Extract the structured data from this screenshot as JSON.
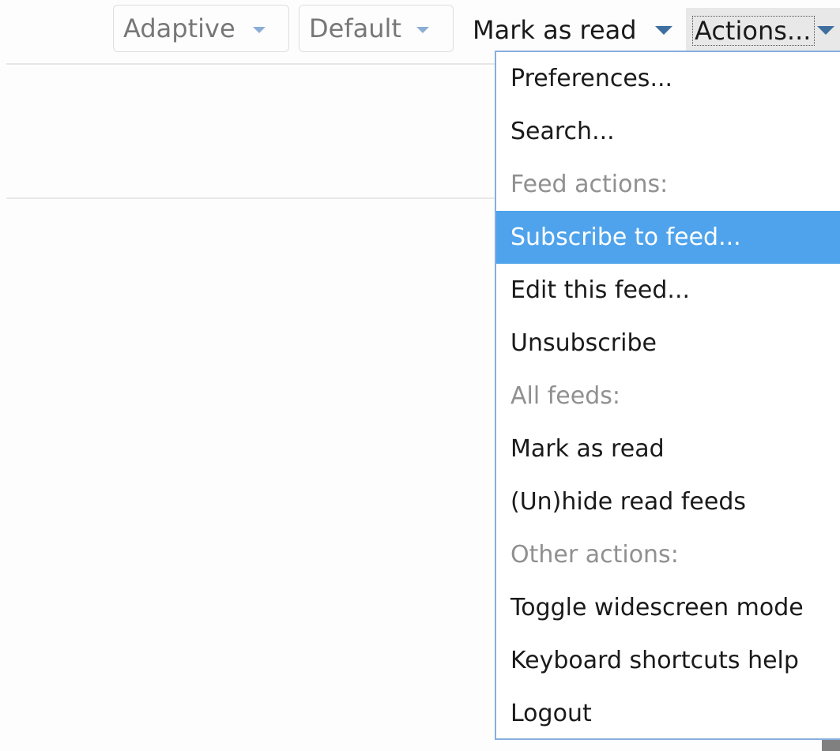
{
  "toolbar": {
    "view_mode": {
      "value": "Adaptive",
      "icon": "chevron-down-icon"
    },
    "order_by": {
      "value": "Default",
      "icon": "chevron-down-icon"
    },
    "mark_as_read": {
      "label": "Mark as read",
      "icon": "caret-down-icon"
    },
    "actions": {
      "label": "Actions...",
      "icon": "caret-down-icon"
    }
  },
  "actions_menu": {
    "preferences": "Preferences...",
    "search": "Search...",
    "feed_actions_heading": "Feed actions:",
    "subscribe": "Subscribe to feed...",
    "edit_feed": "Edit this feed...",
    "unsubscribe": "Unsubscribe",
    "all_feeds_heading": "All feeds:",
    "mark_as_read": "Mark as read",
    "unhide_read": "(Un)hide read feeds",
    "other_actions_heading": "Other actions:",
    "toggle_widescreen": "Toggle widescreen mode",
    "keyboard_help": "Keyboard shortcuts help",
    "logout": "Logout"
  },
  "colors": {
    "highlight": "#4ea3ec",
    "menu_border": "#86aee0",
    "caret": "#3f6f9f",
    "heading_text": "#909090"
  }
}
